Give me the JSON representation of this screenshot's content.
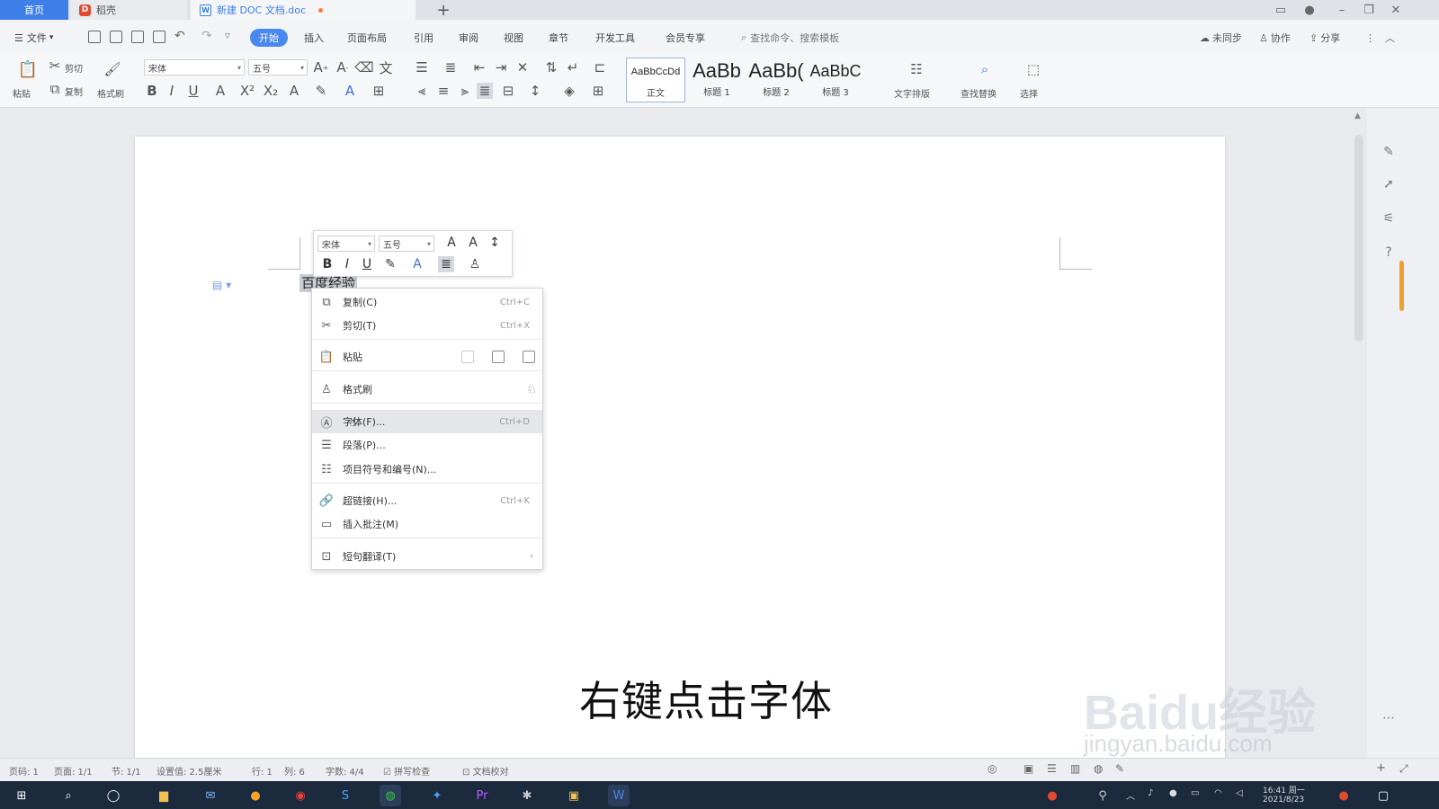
{
  "tabs": {
    "home": "首页",
    "shell": "稻壳",
    "doc": "新建 DOC 文档.doc",
    "new_tab": "+"
  },
  "menubar": {
    "file": "文件",
    "items": [
      "开始",
      "插入",
      "页面布局",
      "引用",
      "审阅",
      "视图",
      "章节",
      "开发工具",
      "会员专享"
    ],
    "active_index": 0,
    "search_placeholder": "查找命令、搜索模板",
    "sync": "未同步",
    "collab": "协作",
    "share": "分享"
  },
  "ribbon": {
    "paste": "粘贴",
    "cut": "剪切",
    "copy": "复制",
    "format_painter": "格式刷",
    "font_name": "宋体",
    "font_size": "五号",
    "styles": [
      {
        "sample": "AaBbCcDd",
        "label": "正文"
      },
      {
        "sample": "AaBb",
        "label": "标题 1"
      },
      {
        "sample": "AaBb(",
        "label": "标题 2"
      },
      {
        "sample": "AaBbC",
        "label": "标题 3"
      }
    ],
    "text_layout": "文字排版",
    "find_replace": "查找替换",
    "select": "选择"
  },
  "document": {
    "selected_text": "百度经验"
  },
  "minibar": {
    "font_name": "宋体",
    "font_size": "五号"
  },
  "context_menu": {
    "items": [
      {
        "label": "复制(C)",
        "shortcut": "Ctrl+C",
        "icon": "copy-icon"
      },
      {
        "label": "剪切(T)",
        "shortcut": "Ctrl+X",
        "icon": "cut-icon"
      },
      {
        "label": "粘贴",
        "shortcut": "",
        "icon": "paste-icon"
      },
      {
        "label": "格式刷",
        "shortcut": "",
        "icon": "format-painter-icon"
      },
      {
        "label": "字体(F)...",
        "shortcut": "Ctrl+D",
        "icon": "font-icon"
      },
      {
        "label": "段落(P)...",
        "shortcut": "",
        "icon": "paragraph-icon"
      },
      {
        "label": "项目符号和编号(N)...",
        "shortcut": "",
        "icon": "list-icon"
      },
      {
        "label": "超链接(H)...",
        "shortcut": "Ctrl+K",
        "icon": "link-icon"
      },
      {
        "label": "插入批注(M)",
        "shortcut": "",
        "icon": "comment-icon"
      },
      {
        "label": "短句翻译(T)",
        "shortcut": "",
        "icon": "translate-icon"
      }
    ],
    "highlighted_index": 4
  },
  "subtitle": "右键点击字体",
  "watermark": {
    "logo": "Baidu经验",
    "url": "jingyan.baidu.com"
  },
  "statusbar": {
    "page_num": "页码: 1",
    "pages": "页面: 1/1",
    "section": "节: 1/1",
    "setting": "设置值: 2.5厘米",
    "row": "行: 1",
    "col": "列: 6",
    "words": "字数: 4/4",
    "spell": "拼写检查",
    "proof": "文档校对"
  },
  "taskbar": {
    "time": "16:41 周一",
    "date": "2021/8/23"
  },
  "colors": {
    "accent": "#4a87ee",
    "taskbar": "#1c2a3e"
  }
}
